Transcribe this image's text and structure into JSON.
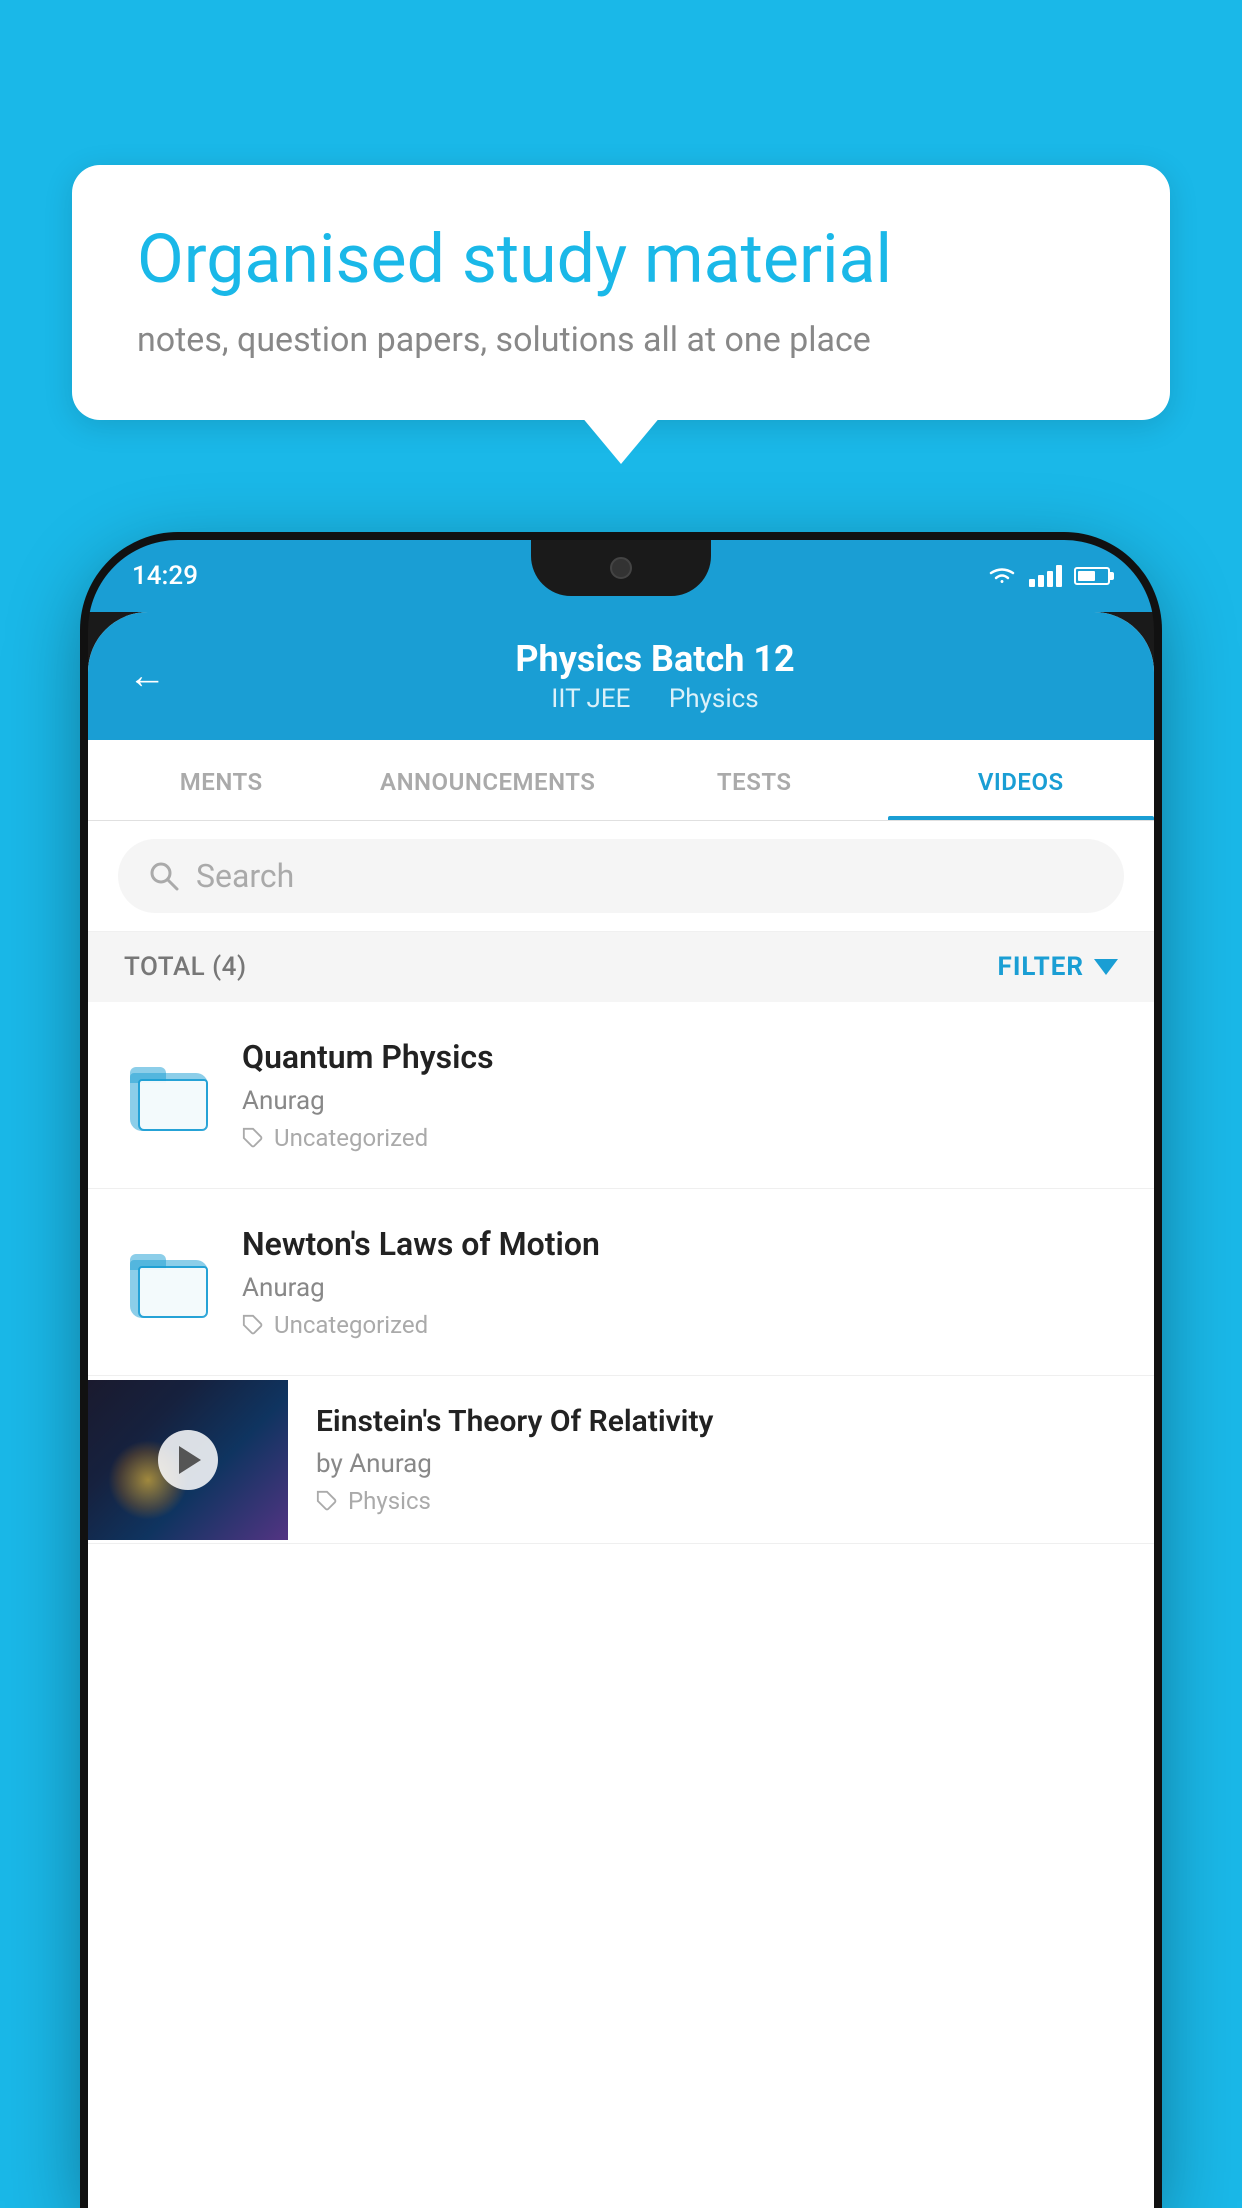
{
  "page": {
    "bg_color": "#1ab8e8"
  },
  "speech_bubble": {
    "title": "Organised study material",
    "subtitle": "notes, question papers, solutions all at one place"
  },
  "status_bar": {
    "time": "14:29"
  },
  "app_header": {
    "title": "Physics Batch 12",
    "subtitle_part1": "IIT JEE",
    "subtitle_part2": "Physics",
    "back_label": "←"
  },
  "tabs": [
    {
      "label": "MENTS",
      "active": false
    },
    {
      "label": "ANNOUNCEMENTS",
      "active": false
    },
    {
      "label": "TESTS",
      "active": false
    },
    {
      "label": "VIDEOS",
      "active": true
    }
  ],
  "search": {
    "placeholder": "Search"
  },
  "filter": {
    "total_label": "TOTAL (4)",
    "filter_label": "FILTER"
  },
  "videos": [
    {
      "title": "Quantum Physics",
      "author": "Anurag",
      "tag": "Uncategorized",
      "has_thumb": false
    },
    {
      "title": "Newton's Laws of Motion",
      "author": "Anurag",
      "tag": "Uncategorized",
      "has_thumb": false
    },
    {
      "title": "Einstein's Theory Of Relativity",
      "author": "by Anurag",
      "tag": "Physics",
      "has_thumb": true
    }
  ]
}
